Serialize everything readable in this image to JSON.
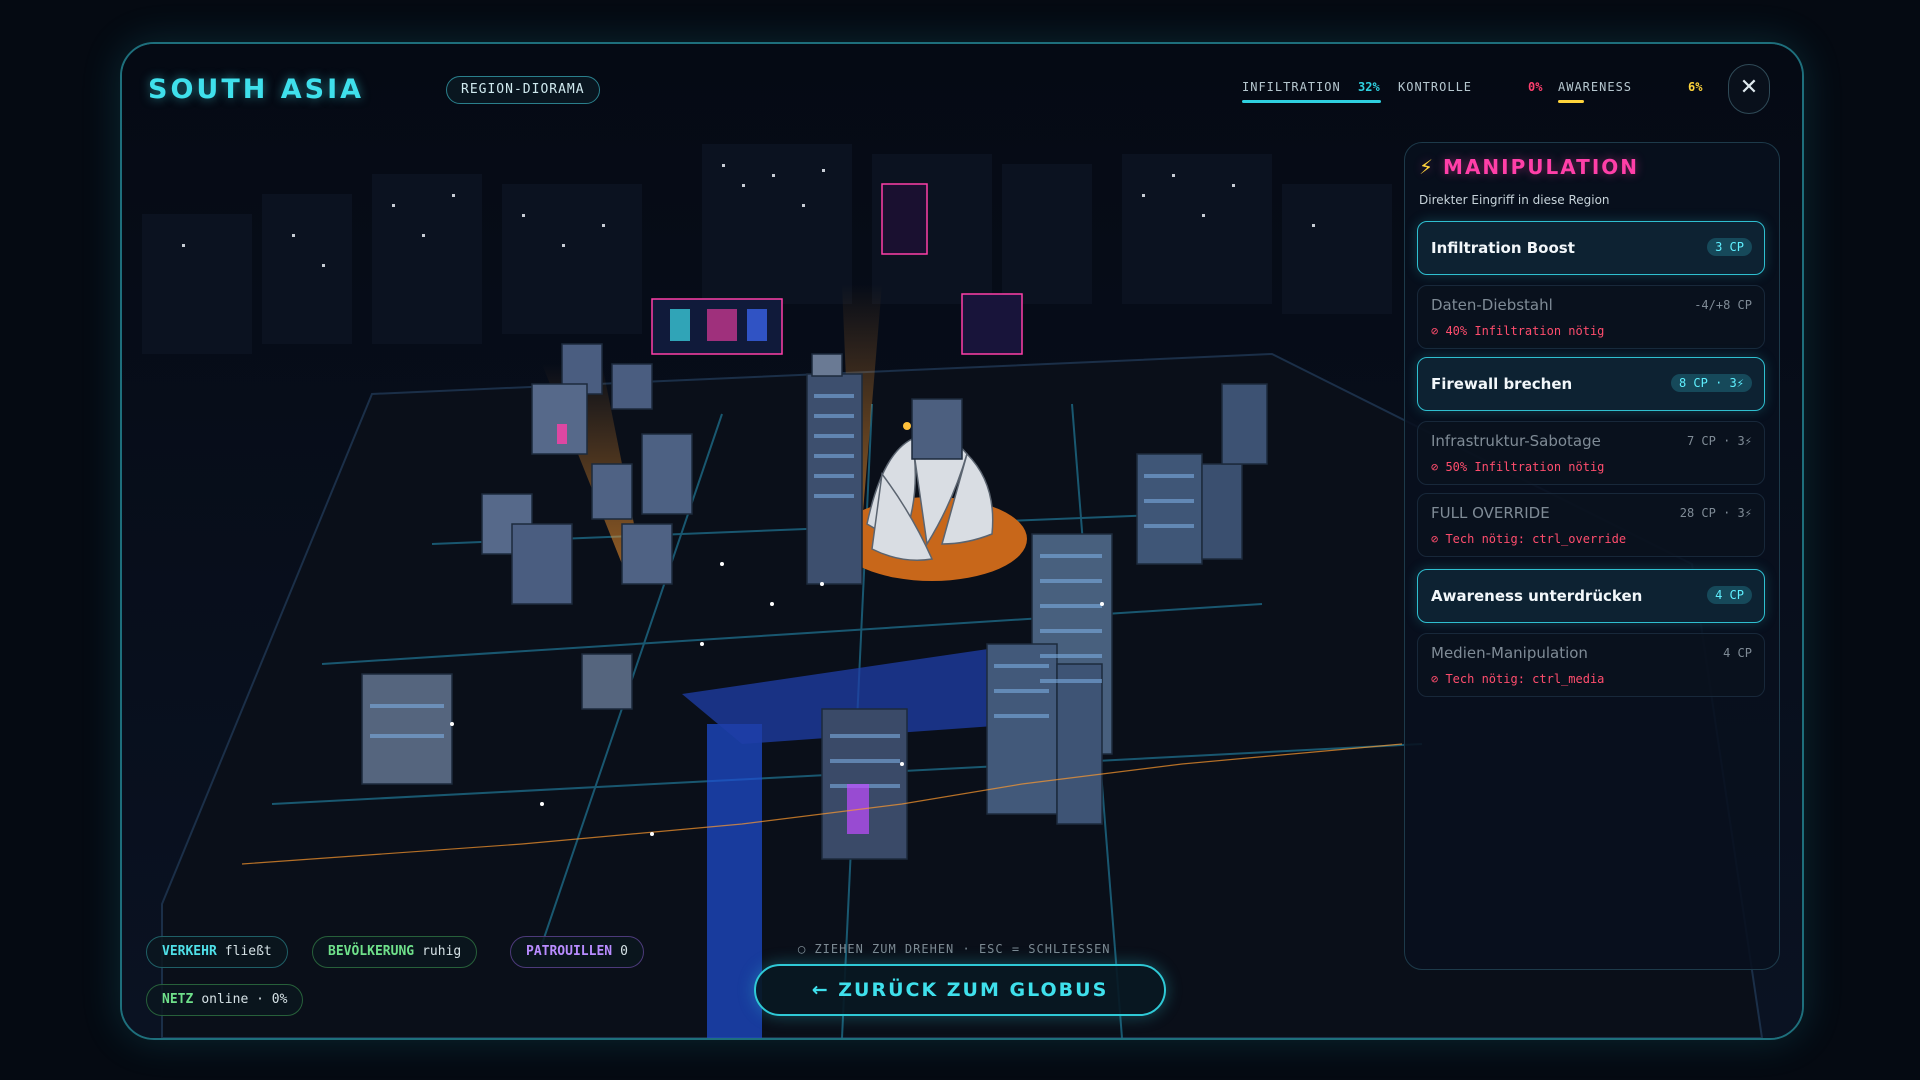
{
  "region": {
    "title": "SOUTH ASIA",
    "badge": "REGION-DIORAMA"
  },
  "stats": [
    {
      "label": "INFILTRATION",
      "value": "32%",
      "fraction": 0.32,
      "color": "#2fd0e0"
    },
    {
      "label": "KONTROLLE",
      "value": "0%",
      "fraction": 0.0,
      "color": "#ff3f6e"
    },
    {
      "label": "AWARENESS",
      "value": "6%",
      "fraction": 0.06,
      "color": "#ffd43b"
    }
  ],
  "close_label": "✕",
  "manipulation": {
    "icon": "bolt-icon",
    "title": "MANIPULATION",
    "subtitle": "Direkter Eingriff in diese Region",
    "actions": [
      {
        "name": "Infiltration Boost",
        "cost": "3 CP",
        "state": "available",
        "requirement": ""
      },
      {
        "name": "Daten-Diebstahl",
        "cost": "-4/+8 CP",
        "state": "locked",
        "requirement": "⊘ 40% Infiltration nötig"
      },
      {
        "name": "Firewall brechen",
        "cost": "8 CP · 3⚡",
        "state": "available",
        "requirement": ""
      },
      {
        "name": "Infrastruktur-Sabotage",
        "cost": "7 CP · 3⚡",
        "state": "locked",
        "requirement": "⊘ 50% Infiltration nötig"
      },
      {
        "name": "FULL OVERRIDE",
        "cost": "28 CP · 3⚡",
        "state": "locked",
        "requirement": "⊘ Tech nötig: ctrl_override"
      },
      {
        "name": "Awareness unterdrücken",
        "cost": "4 CP",
        "state": "available",
        "requirement": ""
      },
      {
        "name": "Medien-Manipulation",
        "cost": "4 CP",
        "state": "locked",
        "requirement": "⊘ Tech nötig: ctrl_media"
      }
    ]
  },
  "status_chips": {
    "traffic": {
      "key": "VERKEHR",
      "value": "fließt",
      "color": "#4fe0e8"
    },
    "population": {
      "key": "BEVÖLKERUNG",
      "value": "ruhig",
      "color": "#6fe08a"
    },
    "patrols": {
      "key": "PATROUILLEN",
      "value": "0",
      "color": "#b98cff"
    },
    "net": {
      "key": "NETZ",
      "value": "online · 0%",
      "color": "#6fe08a"
    }
  },
  "hint": "◯ ZIEHEN ZUM DREHEN · ESC = SCHLIESSEN",
  "back_button": "← ZURÜCK ZUM GLOBUS"
}
